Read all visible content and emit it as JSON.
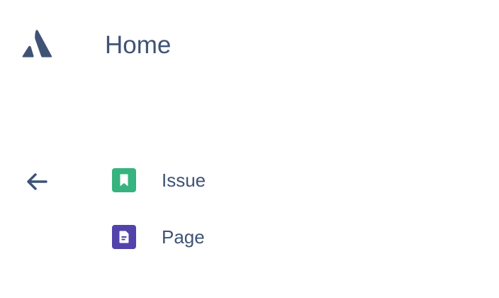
{
  "header": {
    "logo_icon": "atlassian-logo-icon",
    "title": "Home"
  },
  "nav": {
    "back_icon": "arrow-left-icon"
  },
  "create_menu": {
    "items": [
      {
        "label": "Issue",
        "icon": "issue-story-icon",
        "color": "#36b37e"
      },
      {
        "label": "Page",
        "icon": "page-icon",
        "color": "#5243aa"
      }
    ]
  },
  "colors": {
    "text": "#3f5375",
    "logo": "#3f5375"
  }
}
